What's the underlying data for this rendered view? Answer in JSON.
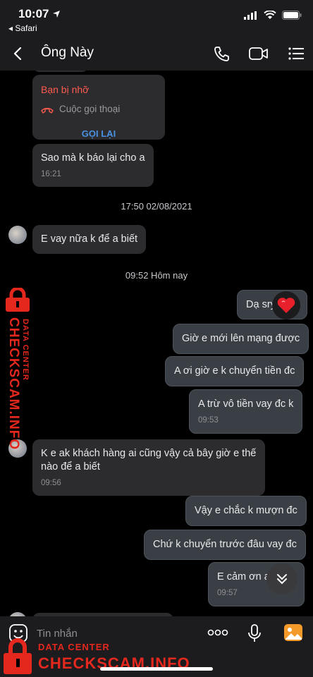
{
  "status_bar": {
    "time": "10:07",
    "back_app": "◂ Safari"
  },
  "header": {
    "contact_name": "Ông Này"
  },
  "messages": {
    "missed_call": {
      "title": "Bạn bị nhỡ",
      "subtitle": "Cuộc gọi thoại",
      "action": "GỌI LẠI"
    },
    "m1": {
      "text": "Sao mà k báo lại cho a",
      "time": "16:21"
    },
    "d1": "17:50 02/08/2021",
    "m2": {
      "text": "E vay nữa k để a biết"
    },
    "d2": "09:52 Hôm nay",
    "m3": {
      "text": "Dạ sry"
    },
    "m4": {
      "text": "Giờ e mới lên mạng được"
    },
    "m5": {
      "text": "A ơi giờ e k chuyển tiền đc"
    },
    "m6": {
      "text": "A trừ vô tiền vay đc k",
      "time": "09:53"
    },
    "m7": {
      "text": "K e ak khách hàng ai cũng vậy cả bây giờ e thế nào để a biết",
      "time": "09:56"
    },
    "m8": {
      "text": "Vậy e chắc k mượn đc"
    },
    "m9": {
      "text": "Chứ k chuyển trước đâu vay đc"
    },
    "m10": {
      "text": "E cảm ơn a",
      "time": "09:57"
    }
  },
  "input": {
    "placeholder": "Tin nhắn"
  },
  "watermark": {
    "line1": "DATA CENTER",
    "line2": "CHECKSCAM.INFO"
  },
  "colors": {
    "background": "#000000",
    "incoming": "#2c2c2e",
    "outgoing": "#3a3f46",
    "accent": "#4a90e2",
    "missed": "#ff5a4f",
    "watermark": "#e4281e"
  }
}
